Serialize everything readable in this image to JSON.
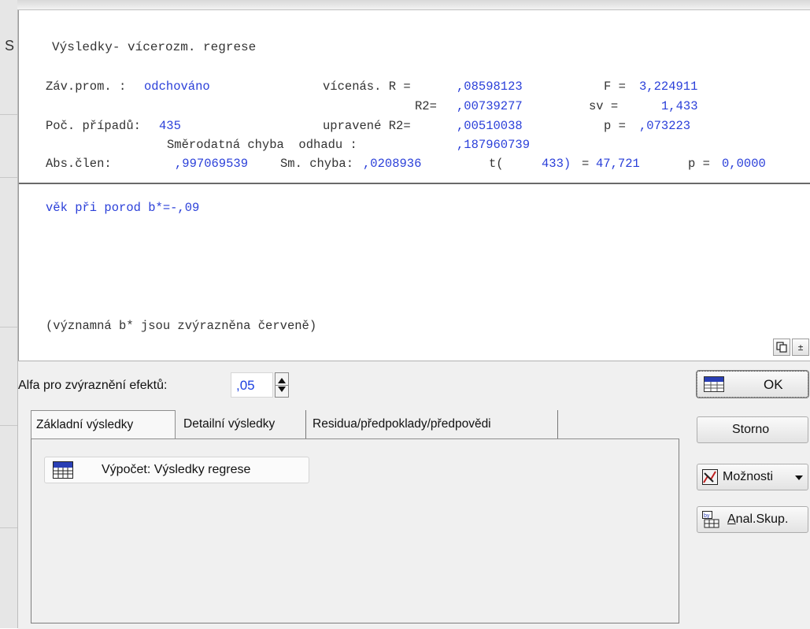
{
  "background_window": {
    "side_label": "S"
  },
  "results": {
    "title": "Výsledky- vícerozm. regrese",
    "zav_prom_label": "Záv.prom. :",
    "zav_prom_value": "odchováno",
    "vicenas_r_label": "vícenás. R =",
    "vicenas_r_value": ",08598123",
    "f_label": "F =",
    "f_value": "3,224911",
    "r2_label": "R2=",
    "r2_value": ",00739277",
    "sv_label": "sv =",
    "sv_value": "1,433",
    "poc_pripadu_label": "Poč. případů:",
    "poc_pripadu_value": "435",
    "upr_r2_label": "upravené R2=",
    "upr_r2_value": ",00510038",
    "p_label": "p =",
    "p_value": ",073223",
    "smer_chyba_label": "Směrodatná chyba  odhadu :",
    "smer_chyba_value": ",187960739",
    "abs_clen_label": "Abs.člen:",
    "abs_clen_value": ",997069539",
    "sm_chyba_label": "Sm. chyba:",
    "sm_chyba_value": ",0208936",
    "t_label": "t(",
    "t_df": "433)",
    "t_eq": "=",
    "t_value": "47,721",
    "p2_label": "p =",
    "p2_value": "0,0000",
    "effect_line": "věk při porod b*=-,09",
    "note": "(významná b* jsou zvýrazněna červeně)"
  },
  "result_buttons": {
    "copy_icon": "copy-icon",
    "expand_icon": "arrow-up-icon",
    "expand_glyph": "±"
  },
  "dialog": {
    "alfa_label": "Alfa pro zvýraznění efektů:",
    "alfa_value": ",05",
    "tabs": [
      {
        "label": "Základní výsledky",
        "active": true
      },
      {
        "label": "Detailní výsledky",
        "active": false
      },
      {
        "label": "Residua/předpoklady/předpovědi",
        "active": false
      }
    ],
    "calc_button": {
      "icon": "summary-icon",
      "label": "Výpočet:  Výsledky regrese"
    },
    "ok_label": "OK",
    "cancel_label": "Storno",
    "options_label": "Možnosti",
    "options_icon": "options-icon",
    "group_label_underlined": "A",
    "group_label_rest": "nal.Skup.",
    "group_icon": "by-group-icon",
    "ok_icon": "ok-icon"
  }
}
